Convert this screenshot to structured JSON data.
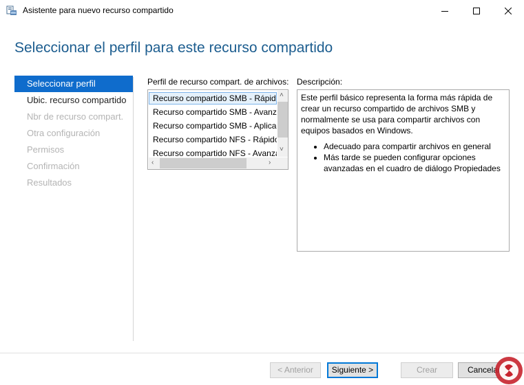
{
  "window": {
    "title": "Asistente para nuevo recurso compartido"
  },
  "page": {
    "heading": "Seleccionar el perfil para este recurso compartido"
  },
  "nav": {
    "items": [
      {
        "label": "Seleccionar perfil",
        "state": "selected"
      },
      {
        "label": "Ubic. recurso compartido",
        "state": "normal"
      },
      {
        "label": "Nbr de recurso compart.",
        "state": "disabled"
      },
      {
        "label": "Otra configuración",
        "state": "disabled"
      },
      {
        "label": "Permisos",
        "state": "disabled"
      },
      {
        "label": "Confirmación",
        "state": "disabled"
      },
      {
        "label": "Resultados",
        "state": "disabled"
      }
    ]
  },
  "profile_list": {
    "label": "Perfil de recurso compart. de archivos:",
    "items": [
      "Recurso compartido SMB - Rápido",
      "Recurso compartido SMB - Avanzado",
      "Recurso compartido SMB - Aplicaciones",
      "Recurso compartido NFS - Rápido",
      "Recurso compartido NFS - Avanzado"
    ],
    "selected_index": 0
  },
  "description": {
    "label": "Descripción:",
    "text": "Este perfil básico representa la forma más rápida de crear un recurso compartido de archivos SMB y normalmente se usa para compartir archivos con equipos basados en Windows.",
    "bullets": [
      "Adecuado para compartir archivos en general",
      "Más tarde se pueden configurar opciones avanzadas en el cuadro de diálogo Propiedades"
    ]
  },
  "buttons": {
    "previous": "< Anterior",
    "next": "Siguiente >",
    "create": "Crear",
    "cancel": "Cancelar"
  },
  "colors": {
    "heading": "#1c5d8f",
    "nav_selected": "#0f6ccc",
    "list_selection": "#e5f1fb"
  }
}
